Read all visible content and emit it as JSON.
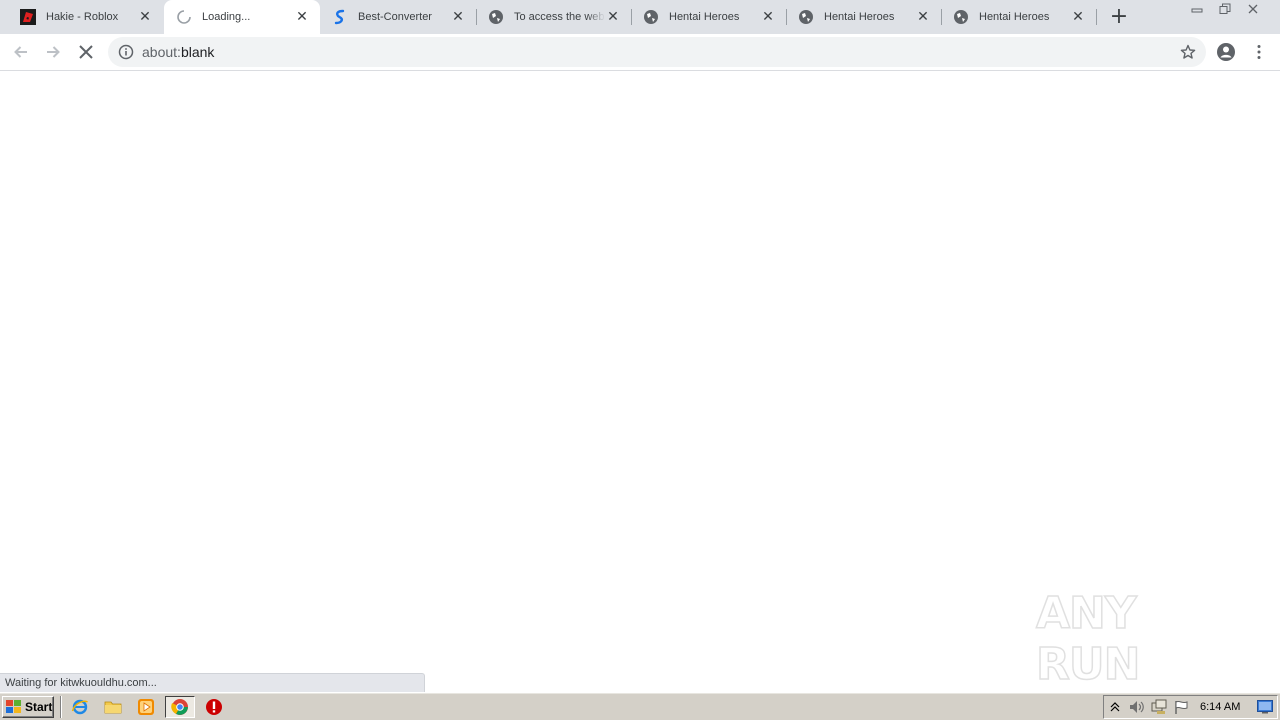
{
  "browser": {
    "tabs": [
      {
        "title": "Hakie - Roblox",
        "favicon": "roblox-icon",
        "active": false
      },
      {
        "title": "Loading...",
        "favicon": "loading-spinner-icon",
        "active": true
      },
      {
        "title": "Best-Converter",
        "favicon": "best-converter-icon",
        "active": false
      },
      {
        "title": "To access the web",
        "favicon": "globe-icon",
        "active": false
      },
      {
        "title": "Hentai Heroes",
        "favicon": "globe-icon",
        "active": false
      },
      {
        "title": "Hentai Heroes",
        "favicon": "globe-icon",
        "active": false
      },
      {
        "title": "Hentai Heroes",
        "favicon": "globe-icon",
        "active": false
      }
    ],
    "close_glyph": "✕",
    "new_tab_glyph": "+",
    "omnibox": {
      "scheme": "about:",
      "host": "blank"
    },
    "status_text": "Waiting for kitwkuouldhu.com..."
  },
  "watermark": {
    "text": "ANY RUN"
  },
  "taskbar": {
    "start_label": "Start",
    "clock": "6:14 AM"
  },
  "colors": {
    "tab_strip": "#dee1e6",
    "active_tab": "#ffffff",
    "omnibox": "#f1f3f4",
    "taskbar": "#d4d0c8",
    "best_converter_accent": "#1a73e8",
    "stop_icon_red": "#cc0000"
  }
}
